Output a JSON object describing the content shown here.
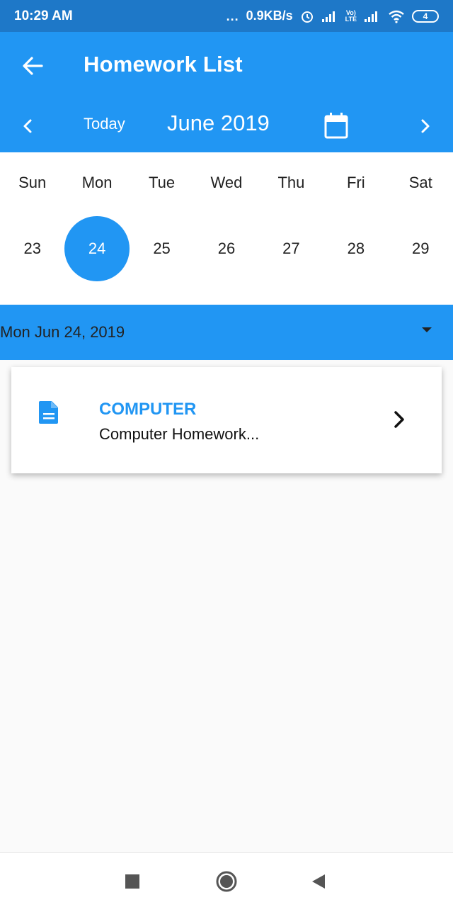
{
  "status_bar": {
    "time": "10:29 AM",
    "dots": "...",
    "network_speed": "0.9KB/s",
    "lte_top": "Vo)",
    "lte_bottom": "LTE",
    "battery": "4"
  },
  "app_bar": {
    "title": "Homework List",
    "back_icon": "arrow-left-icon"
  },
  "calendar_nav": {
    "today_label": "Today",
    "month_label": "June 2019"
  },
  "week": {
    "weekdays": [
      "Sun",
      "Mon",
      "Tue",
      "Wed",
      "Thu",
      "Fri",
      "Sat"
    ],
    "dates": [
      "23",
      "24",
      "25",
      "26",
      "27",
      "28",
      "29"
    ],
    "selected_date": "24"
  },
  "date_header": {
    "label": "Mon Jun 24, 2019"
  },
  "homework": {
    "subject": "COMPUTER",
    "description": "Computer Homework..."
  },
  "colors": {
    "primary": "#2196f3",
    "status_bar": "#1e78c8",
    "background": "#fafafa"
  }
}
